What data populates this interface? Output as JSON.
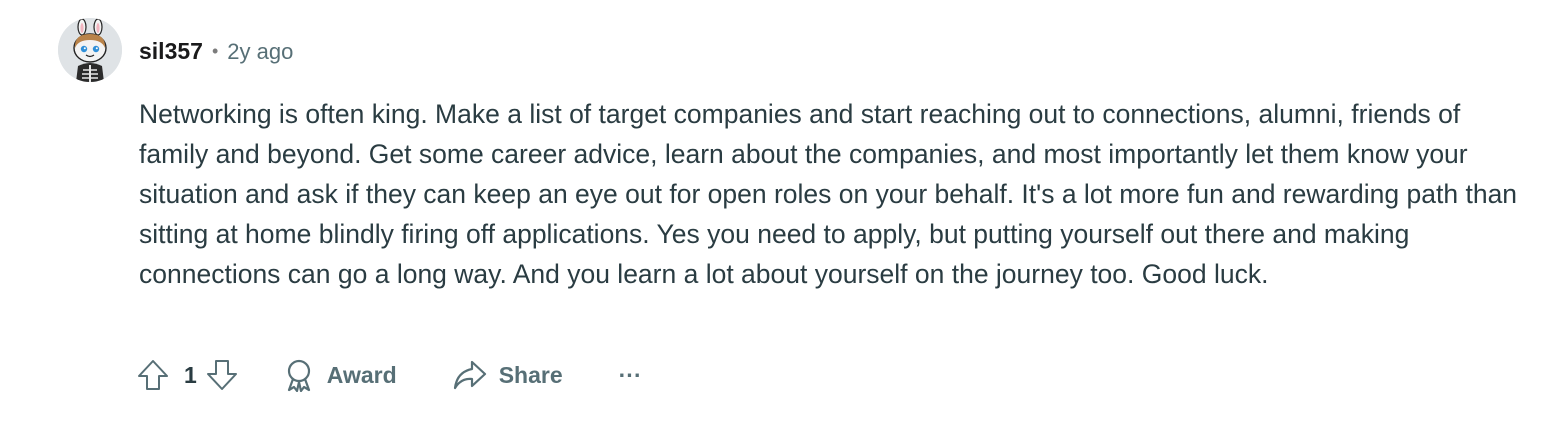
{
  "comment": {
    "username": "sil357",
    "separator": "•",
    "timestamp": "2y ago",
    "body": "Networking is often king. Make a list of target companies and start reaching out to connections, alumni, friends of family and beyond. Get some career advice, learn about the companies, and most importantly let them know your situation and ask if they can keep an eye out for open roles on your behalf. It's a lot more fun and rewarding path than sitting at home blindly firing off applications. Yes you need to apply, but putting yourself out there and making connections can go a long way. And you learn a lot about yourself on the journey too. Good luck."
  },
  "actions": {
    "vote_count": "1",
    "award_label": "Award",
    "share_label": "Share",
    "more_label": "···"
  },
  "icons": {
    "avatar": "snoo-avatar-icon",
    "upvote": "arrow-up-icon",
    "downvote": "arrow-down-icon",
    "award": "award-icon",
    "share": "share-arrow-icon"
  },
  "colors": {
    "text_primary": "#1a1a1b",
    "text_body": "#2a3c42",
    "text_muted": "#576f76"
  }
}
